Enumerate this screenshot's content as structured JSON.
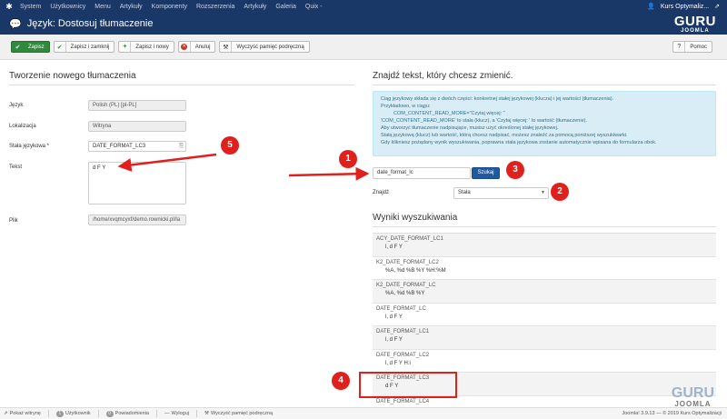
{
  "topnav": {
    "items": [
      "System",
      "Użytkownicy",
      "Menu",
      "Artykuły",
      "Komponenty",
      "Rozszerzenia",
      "Artykuły",
      "Galeria",
      "Quix -"
    ],
    "site_name": "Kurs Optymaliz..."
  },
  "header": {
    "title": "Język: Dostosuj tłumaczenie"
  },
  "logo": {
    "top": "GURU",
    "bottom": "JOOMLA"
  },
  "toolbar": {
    "save": "Zapisz",
    "save_close": "Zapisz i zamknij",
    "save_new": "Zapisz i nowy",
    "cancel": "Anuluj",
    "clear_cache": "Wyczyść pamięć podręczną",
    "help": "Pomoc"
  },
  "left": {
    "title": "Tworzenie nowego tłumaczenia",
    "language_label": "Język",
    "language_value": "Polish (PL) [pl-PL]",
    "location_label": "Lokalizacja",
    "location_value": "Witryna",
    "constant_label": "Stała językowa *",
    "constant_value": "DATE_FORMAT_LC3",
    "text_label": "Tekst",
    "text_value": "d F Y",
    "file_label": "Plik",
    "file_value": "/home/xvqmcyxf/demo.rownicki.pl/la"
  },
  "right": {
    "title": "Znajdź tekst, który chcesz zmienić.",
    "info": [
      "Ciąg językowy składa się z dwóch części: konkretnej stałej językowej (klucza) i jej wartości (tłumaczenia).",
      "Przykładowo, w ciągu:",
      "COM_CONTENT_READ_MORE=\"Czytaj więcej: \"",
      "'COM_CONTENT_READ_MORE' to stała (klucz), a 'Czytaj więcej: ' to wartość (tłumaczenie).",
      "Aby utworzyć tłumaczenie nadpisujące, musisz użyć określonej stałej językowej.",
      "Stałą językową (klucz) lub wartość, którą chcesz nadpisać, możesz znaleźć za pomocą poniższej wyszukiwarki.",
      "Gdy klikniesz pożądany wynik wyszukiwania, poprawna stała językowa zostanie automatycznie wpisana do formularza obok."
    ],
    "search_value": "date_format_lc",
    "search_button": "Szukaj",
    "find_label": "Znajdź",
    "find_select": "Stała",
    "results_title": "Wyniki wyszukiwania",
    "results": [
      {
        "key": "ACY_DATE_FORMAT_LC1",
        "value": "l, d F Y"
      },
      {
        "key": "K2_DATE_FORMAT_LC2",
        "value": "%A, %d %B %Y %H:%M"
      },
      {
        "key": "K2_DATE_FORMAT_LC",
        "value": "%A, %d %B %Y"
      },
      {
        "key": "DATE_FORMAT_LC",
        "value": "l, d F Y"
      },
      {
        "key": "DATE_FORMAT_LC1",
        "value": "l, d F Y"
      },
      {
        "key": "DATE_FORMAT_LC2",
        "value": "l, d F Y H:i"
      },
      {
        "key": "DATE_FORMAT_LC3",
        "value": "d F Y"
      },
      {
        "key": "DATE_FORMAT_LC4",
        "value": ""
      }
    ]
  },
  "annotations": {
    "b1": "1",
    "b2": "2",
    "b3": "3",
    "b4": "4",
    "b5": "5",
    "color": "#e0201c"
  },
  "watermark": {
    "top": "GURU",
    "bottom": "JOOMLA"
  },
  "status": {
    "view_site": "Pokaż witrynę",
    "users_count": "1",
    "users": "Użytkownik",
    "notifications_count": "0",
    "notifications": "Powiadomienia",
    "logout": "Wyloguj",
    "clear_cache": "Wyczyść pamięć podręczną",
    "version": "Joomla! 3.9.13 — © 2019 Kurs Optymalizacji"
  }
}
